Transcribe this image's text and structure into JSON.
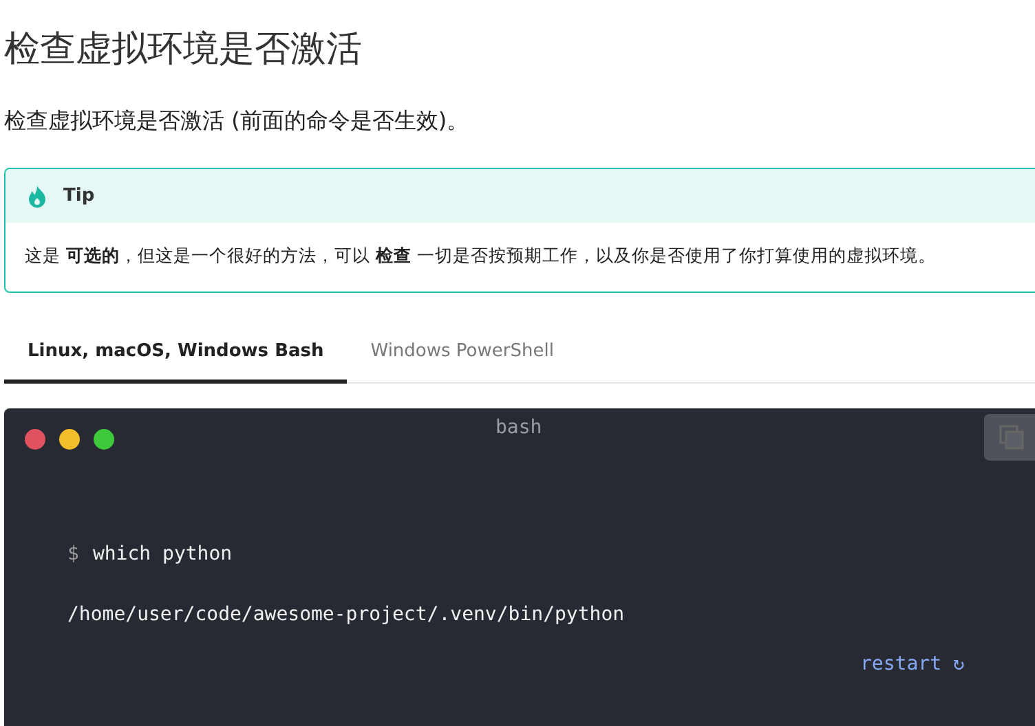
{
  "heading": "检查虚拟环境是否激活",
  "intro": "检查虚拟环境是否激活 (前面的命令是否生效)。",
  "tip": {
    "title": "Tip",
    "text": "这是 **可选的**，但这是一个很好的方法，可以 **检查** 一切是否按预期工作，以及你是否使用了你打算使用的虚拟环境。"
  },
  "tabs": [
    {
      "label": "Linux, macOS, Windows Bash",
      "selected": true
    },
    {
      "label": "Windows PowerShell",
      "selected": false
    }
  ],
  "terminal": {
    "title": "bash",
    "lines": [
      {
        "kind": "command",
        "prompt": "$",
        "text": "which python"
      },
      {
        "kind": "output",
        "text": "/home/user/code/awesome-project/.venv/bin/python"
      }
    ],
    "restart": "restart ↻"
  }
}
